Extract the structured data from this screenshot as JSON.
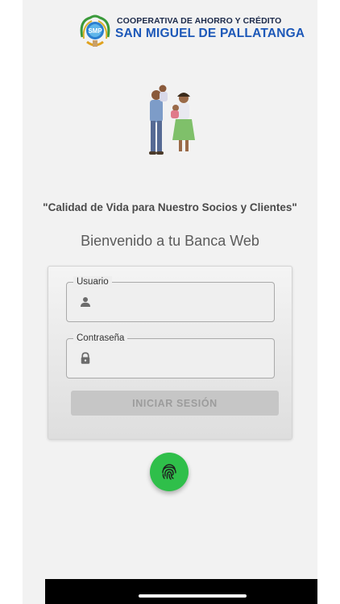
{
  "header": {
    "line1": "COOPERATIVA DE AHORRO Y CRÉDITO",
    "line2": "SAN MIGUEL DE PALLATANGA",
    "emblem_letters": "SMP"
  },
  "slogan": "\"Calidad de Vida para Nuestro Socios y Clientes\"",
  "welcome": "Bienvenido a tu Banca Web",
  "login": {
    "username": {
      "label": "Usuario",
      "value": "",
      "icon": "person-icon"
    },
    "password": {
      "label": "Contraseña",
      "value": "",
      "icon": "lock-icon"
    },
    "submit_label": "INICIAR SESIÓN",
    "submit_enabled": false
  },
  "fingerprint": {
    "icon": "fingerprint-icon",
    "color": "#2fbf4a"
  },
  "colors": {
    "brand_blue": "#1d58b8",
    "brand_dark": "#1c2a4a",
    "background": "#f2f2f2",
    "button_disabled": "#c6c6c6"
  }
}
